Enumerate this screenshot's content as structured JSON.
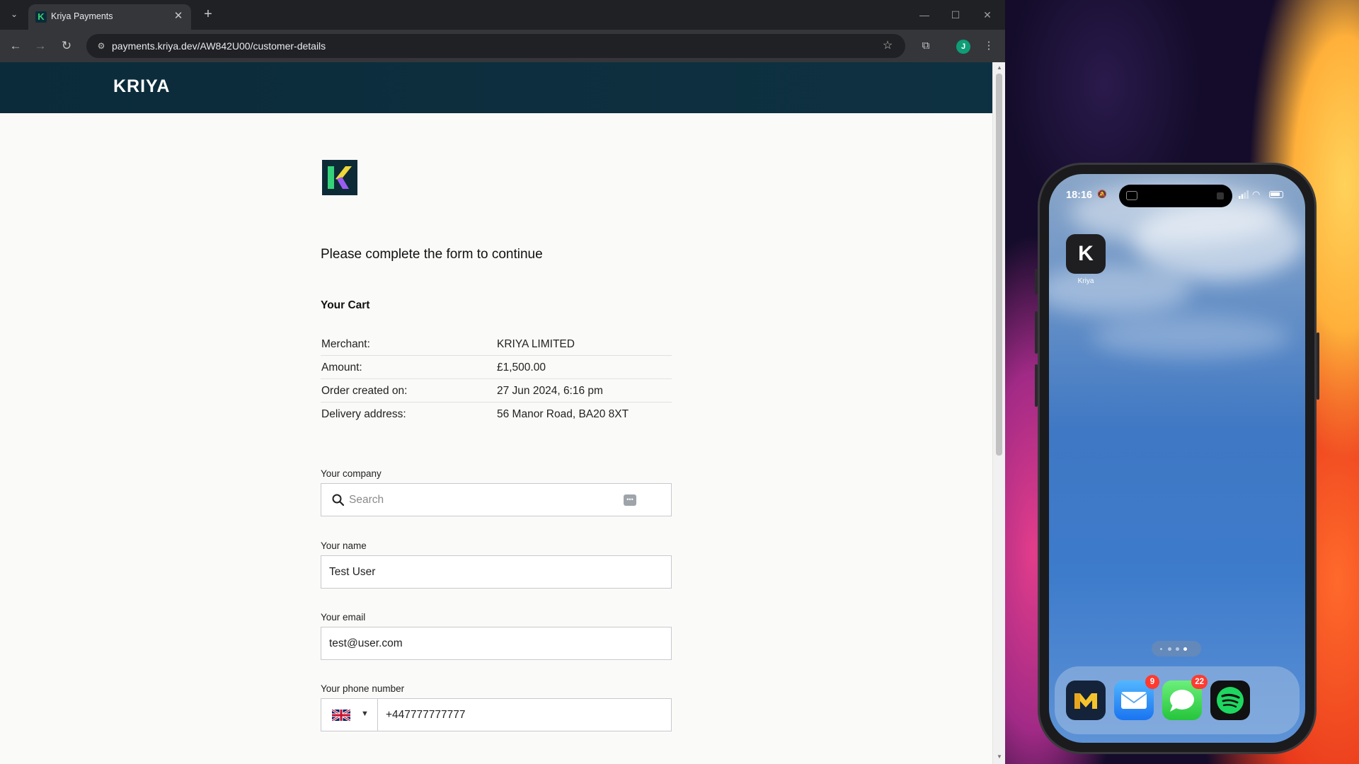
{
  "browser": {
    "tab_title": "Kriya Payments",
    "url": "payments.kriya.dev/AW842U00/customer-details",
    "profile_initial": "J"
  },
  "page": {
    "brand": "KRIYA",
    "form_title": "Please complete the form to continue",
    "cart": {
      "title": "Your Cart",
      "rows": [
        {
          "label": "Merchant:",
          "value": "KRIYA LIMITED"
        },
        {
          "label": "Amount:",
          "value": "£1,500.00"
        },
        {
          "label": "Order created on:",
          "value": "27 Jun 2024, 6:16 pm"
        },
        {
          "label": "Delivery address:",
          "value": "56 Manor Road, BA20 8XT"
        }
      ]
    },
    "fields": {
      "company": {
        "label": "Your company",
        "placeholder": "Search"
      },
      "name": {
        "label": "Your name",
        "value": "Test User"
      },
      "email": {
        "label": "Your email",
        "value": "test@user.com"
      },
      "phone": {
        "label": "Your phone number",
        "value": "+447777777777",
        "country": "GB"
      }
    }
  },
  "phone": {
    "time": "18:16",
    "home_app_label": "Kriya",
    "home_app_letter": "K",
    "dock": [
      {
        "name": "Monzo-like app",
        "icon": "m-logo-icon"
      },
      {
        "name": "Mail",
        "badge": "9",
        "icon": "mail-icon"
      },
      {
        "name": "Messages",
        "badge": "22",
        "icon": "messages-icon"
      },
      {
        "name": "Spotify",
        "icon": "spotify-icon"
      }
    ]
  },
  "colors": {
    "header_bg": "#0b2b3a",
    "brand_green": "#36d27a",
    "brand_purple": "#9b5cf2",
    "badge_red": "#ff3b30"
  }
}
